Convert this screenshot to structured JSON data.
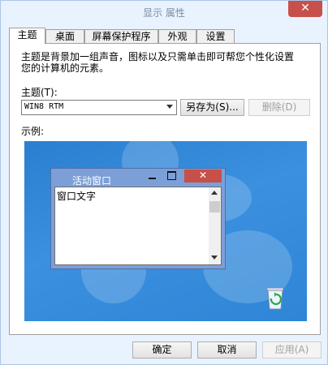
{
  "window": {
    "title": "显示 属性",
    "close_glyph": "✕"
  },
  "tabs": [
    {
      "label": "主题",
      "active": true
    },
    {
      "label": "桌面",
      "active": false
    },
    {
      "label": "屏幕保护程序",
      "active": false
    },
    {
      "label": "外观",
      "active": false
    },
    {
      "label": "设置",
      "active": false
    }
  ],
  "theme_tab": {
    "description_line1": "主题是背景加一组声音，图标以及只需单击即可帮您个性化设置",
    "description_line2": "您的计算机的元素。",
    "theme_label": "主题(T):",
    "theme_value": "WIN8 RTM",
    "save_as_label": "另存为(S)...",
    "delete_label": "删除(D)",
    "preview_label": "示例:"
  },
  "preview": {
    "window_title": "活动窗口",
    "window_text": "窗口文字",
    "close_glyph": "✕",
    "recycle_bin_icon": "recycle-bin-icon"
  },
  "footer": {
    "ok_label": "确定",
    "cancel_label": "取消",
    "apply_label": "应用(A)"
  },
  "colors": {
    "accent": "#2f86d6",
    "close": "#c7504a",
    "active_title": "#7c9fd8"
  }
}
